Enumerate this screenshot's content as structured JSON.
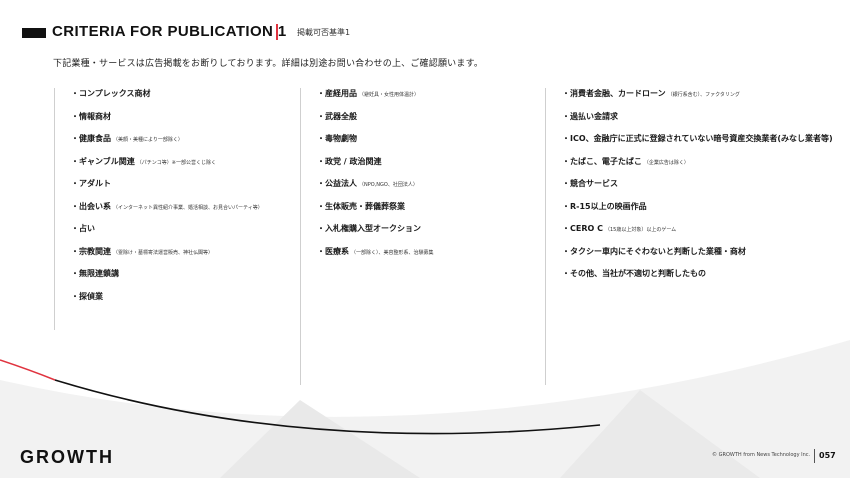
{
  "header": {
    "title": "CRITERIA FOR PUBLICATION 1",
    "subtitle": "掲載可否基準1"
  },
  "lead_text": "下記業種・サービスは広告掲載をお断りしております。詳細は別途お問い合わせの上、ご確認願います。",
  "columns": [
    {
      "items": [
        {
          "label": "・コンプレックス商材",
          "note": ""
        },
        {
          "label": "・情報商材",
          "note": ""
        },
        {
          "label": "・健康食品",
          "note": "（美顔・美種により一部除く）"
        },
        {
          "label": "・ギャンブル関連",
          "note": "（パチンコ等）※一部公営くじ除く"
        },
        {
          "label": "・アダルト",
          "note": ""
        },
        {
          "label": "・出会い系",
          "note": "（インターネット異性紹介事業、婚活相談、お見合いパーティ等）"
        },
        {
          "label": "・占い",
          "note": ""
        },
        {
          "label": "・宗教関連",
          "note": "（霊除け・墓標寄法運営販売、神社仏閣等）"
        },
        {
          "label": "・無限連鎖講",
          "note": ""
        },
        {
          "label": "・探偵業",
          "note": ""
        }
      ]
    },
    {
      "items": [
        {
          "label": "・産経用品",
          "note": "（避妊具・女性用体温計）"
        },
        {
          "label": "・武器全般",
          "note": ""
        },
        {
          "label": "・毒物劇物",
          "note": ""
        },
        {
          "label": "・政党 / 政治関連",
          "note": ""
        },
        {
          "label": "・公益法人",
          "note": "（NPO,NGO、社団法人）"
        },
        {
          "label": "・生体販売・葬儀葬祭業",
          "note": ""
        },
        {
          "label": "・入札権購入型オークション",
          "note": ""
        },
        {
          "label": "・医療系",
          "note": "（一部除く）、美容整形系、治験募集"
        }
      ]
    },
    {
      "items": [
        {
          "label": "・消費者金融、カードローン",
          "note": "（銀行系含む）、ファクタリング"
        },
        {
          "label": "・過払い金請求",
          "note": ""
        },
        {
          "label": "・ICO、金融庁に正式に登録されていない暗号資産交換業者(みなし業者等)",
          "note": ""
        },
        {
          "label": "・たばこ、電子たばこ",
          "note": "（企業広告は除く）"
        },
        {
          "label": "・競合サービス",
          "note": ""
        },
        {
          "label": "・R-15以上の映画作品",
          "note": ""
        },
        {
          "label": "・CERO C",
          "note": "（15歳以上対象）以上のゲーム"
        },
        {
          "label": "・タクシー車内にそぐわないと判断した業種・商材",
          "note": ""
        },
        {
          "label": "・その他、当社が不適切と判断したもの",
          "note": ""
        }
      ]
    }
  ],
  "footer": {
    "logo": "GROWTH",
    "copyright": "© GROWTH from News Technology Inc.",
    "page_number": "057",
    "accent_color": "#e0333f"
  }
}
